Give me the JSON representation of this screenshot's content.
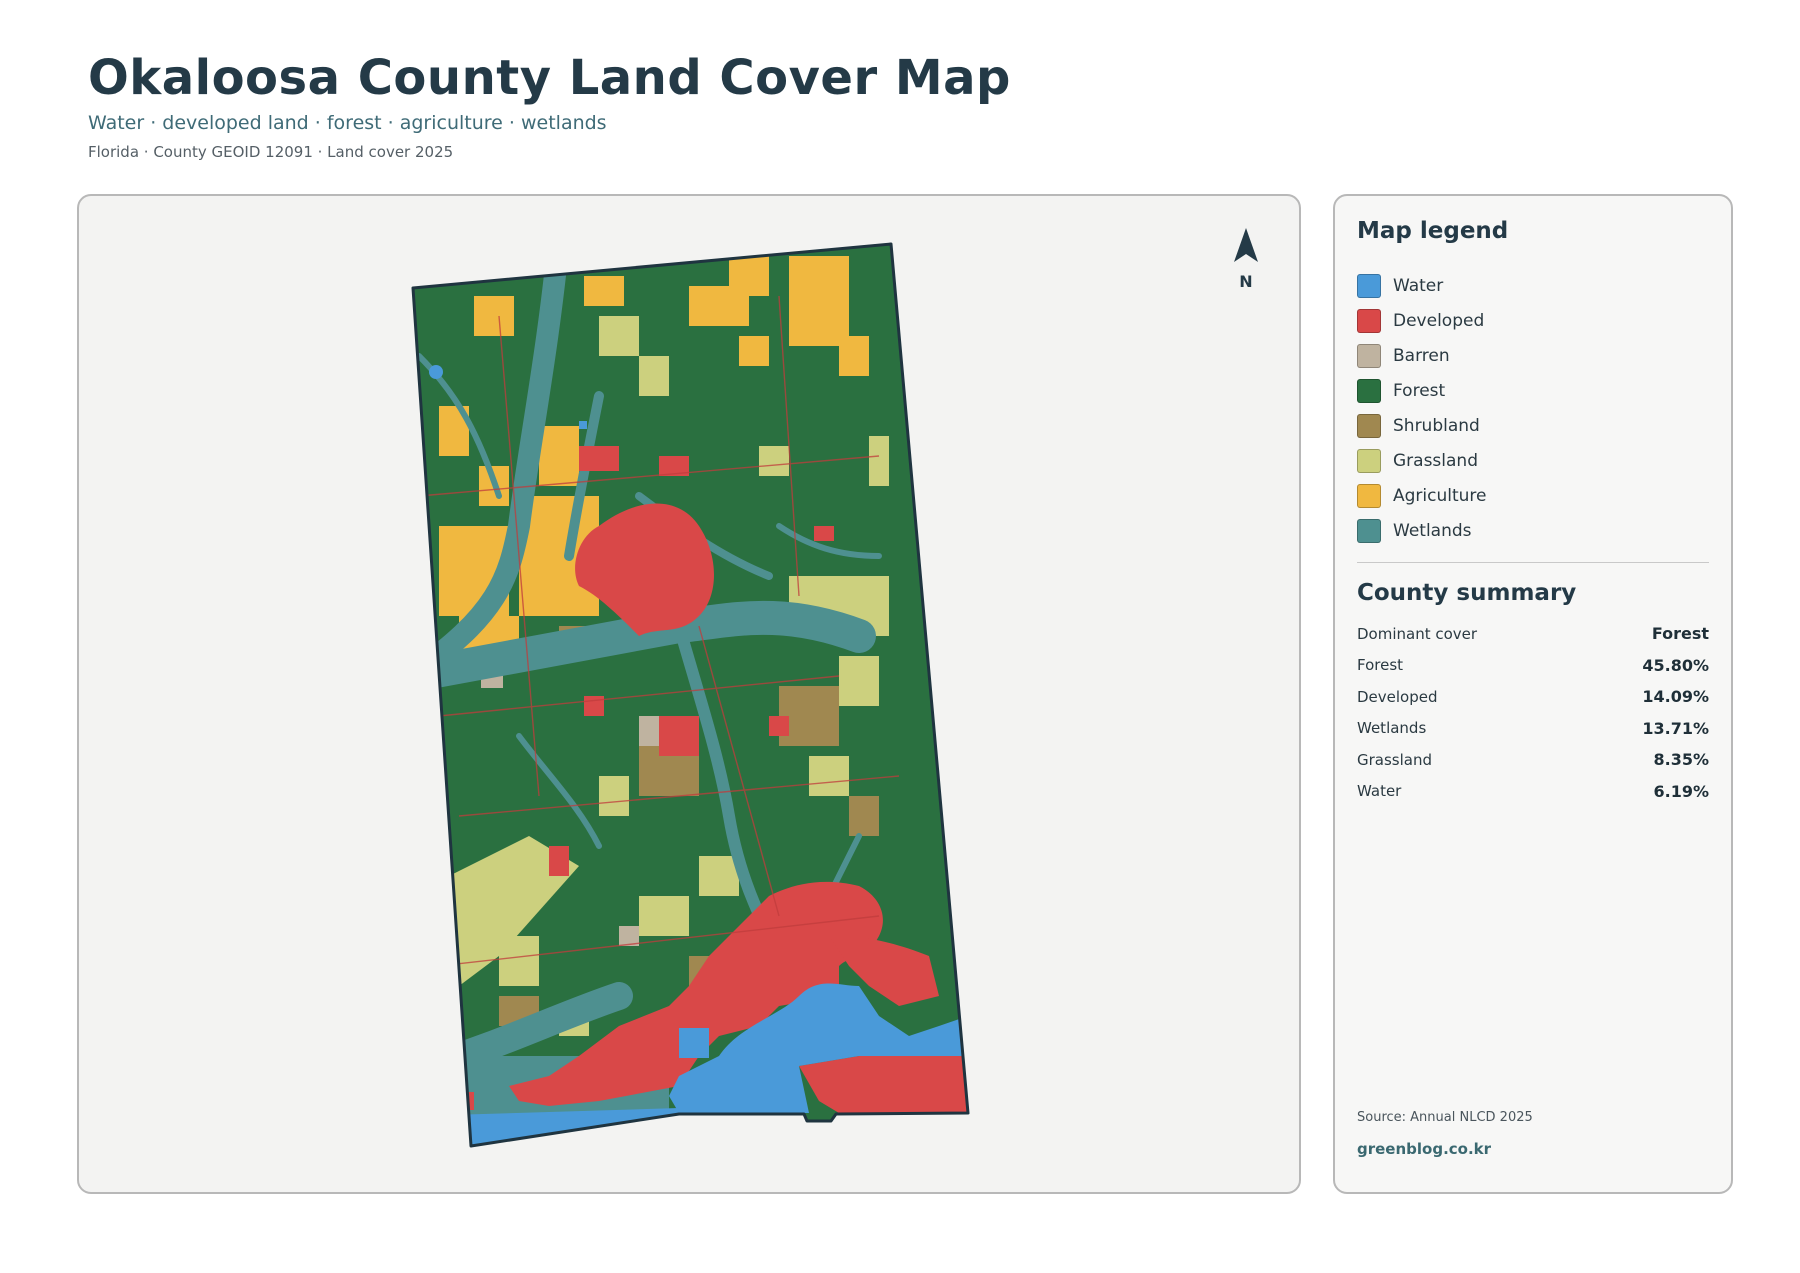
{
  "header": {
    "title": "Okaloosa County Land Cover Map",
    "subtitle": "Water · developed land · forest · agriculture · wetlands",
    "meta": "Florida · County GEOID 12091 · Land cover 2025"
  },
  "map": {
    "north_label": "N",
    "icons": {
      "north": "north-arrow-icon"
    }
  },
  "legend": {
    "title": "Map legend",
    "items": [
      {
        "label": "Water",
        "color": "#4a9ad9"
      },
      {
        "label": "Developed",
        "color": "#d94848"
      },
      {
        "label": "Barren",
        "color": "#bfb3a0"
      },
      {
        "label": "Forest",
        "color": "#2a7040"
      },
      {
        "label": "Shrubland",
        "color": "#a08850"
      },
      {
        "label": "Grassland",
        "color": "#ccd07e"
      },
      {
        "label": "Agriculture",
        "color": "#f0b840"
      },
      {
        "label": "Wetlands",
        "color": "#4e9090"
      }
    ]
  },
  "summary": {
    "title": "County summary",
    "rows": [
      {
        "key": "Dominant cover",
        "value": "Forest"
      },
      {
        "key": "Forest",
        "value": "45.80%"
      },
      {
        "key": "Developed",
        "value": "14.09%"
      },
      {
        "key": "Wetlands",
        "value": "13.71%"
      },
      {
        "key": "Grassland",
        "value": "8.35%"
      },
      {
        "key": "Water",
        "value": "6.19%"
      }
    ]
  },
  "footer": {
    "source": "Source: Annual NLCD 2025",
    "brand": "greenblog.co.kr"
  }
}
